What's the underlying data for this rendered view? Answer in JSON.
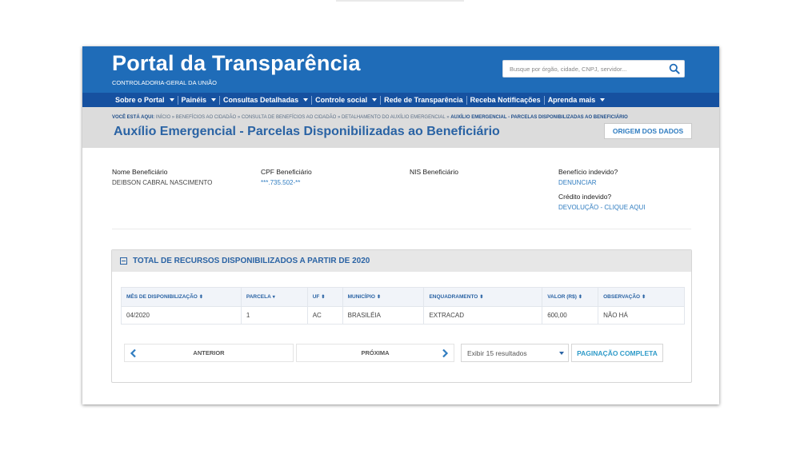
{
  "header": {
    "title": "Portal da Transparência",
    "subtitle": "CONTROLADORIA-GERAL DA UNIÃO",
    "search_placeholder": "Busque por órgão, cidade, CNPJ, servidor..."
  },
  "nav": {
    "items": [
      {
        "label": "Sobre o Portal",
        "dropdown": true
      },
      {
        "label": "Painéis",
        "dropdown": true
      },
      {
        "label": "Consultas Detalhadas",
        "dropdown": true
      },
      {
        "label": "Controle social",
        "dropdown": true
      },
      {
        "label": "Rede de Transparência",
        "dropdown": false
      },
      {
        "label": "Receba Notificações",
        "dropdown": false
      },
      {
        "label": "Aprenda mais",
        "dropdown": true
      }
    ]
  },
  "breadcrumb": {
    "prefix": "VOCÊ ESTÁ AQUI:",
    "trail": "INÍCIO » BENEFÍCIOS AO CIDADÃO » CONSULTA DE BENEFÍCIOS AO CIDADÃO » DETALHAMENTO DO AUXÍLIO EMERGENCIAL »",
    "current": "AUXÍLIO EMERGENCIAL - PARCELAS DISPONIBILIZADAS AO BENEFICIÁRIO"
  },
  "page": {
    "title": "Auxílio Emergencial - Parcelas Disponibilizadas ao Beneficiário",
    "origem_label": "ORIGEM DOS DADOS"
  },
  "beneficiary": {
    "name_label": "Nome Beneficiário",
    "name_value": "DEIBSON CABRAL NASCIMENTO",
    "cpf_label": "CPF Beneficiário",
    "cpf_value": "***.735.502-**",
    "nis_label": "NIS Beneficiário",
    "indevido_label": "Benefício indevido?",
    "indevido_link": "DENUNCIAR",
    "credito_label": "Crédito indevido?",
    "credito_link": "DEVOLUÇÃO - CLIQUE AQUI"
  },
  "panel": {
    "title": "TOTAL DE RECURSOS DISPONIBILIZADOS A PARTIR DE 2020",
    "columns": [
      "MÊS DE DISPONIBILIZAÇÃO",
      "PARCELA",
      "UF",
      "MUNICÍPIO",
      "ENQUADRAMENTO",
      "VALOR (R$)",
      "OBSERVAÇÃO"
    ],
    "rows": [
      [
        "04/2020",
        "1",
        "AC",
        "BRASILÉIA",
        "EXTRACAD",
        "600,00",
        "NÃO HÁ"
      ]
    ]
  },
  "pagination": {
    "prev_label": "ANTERIOR",
    "next_label": "PRÓXIMA",
    "per_page": "Exibir 15 resultados",
    "full_label": "PAGINAÇÃO COMPLETA"
  },
  "colors": {
    "header_blue": "#1f6cb8",
    "nav_blue": "#1651a0",
    "link_blue": "#2f7cc0"
  }
}
